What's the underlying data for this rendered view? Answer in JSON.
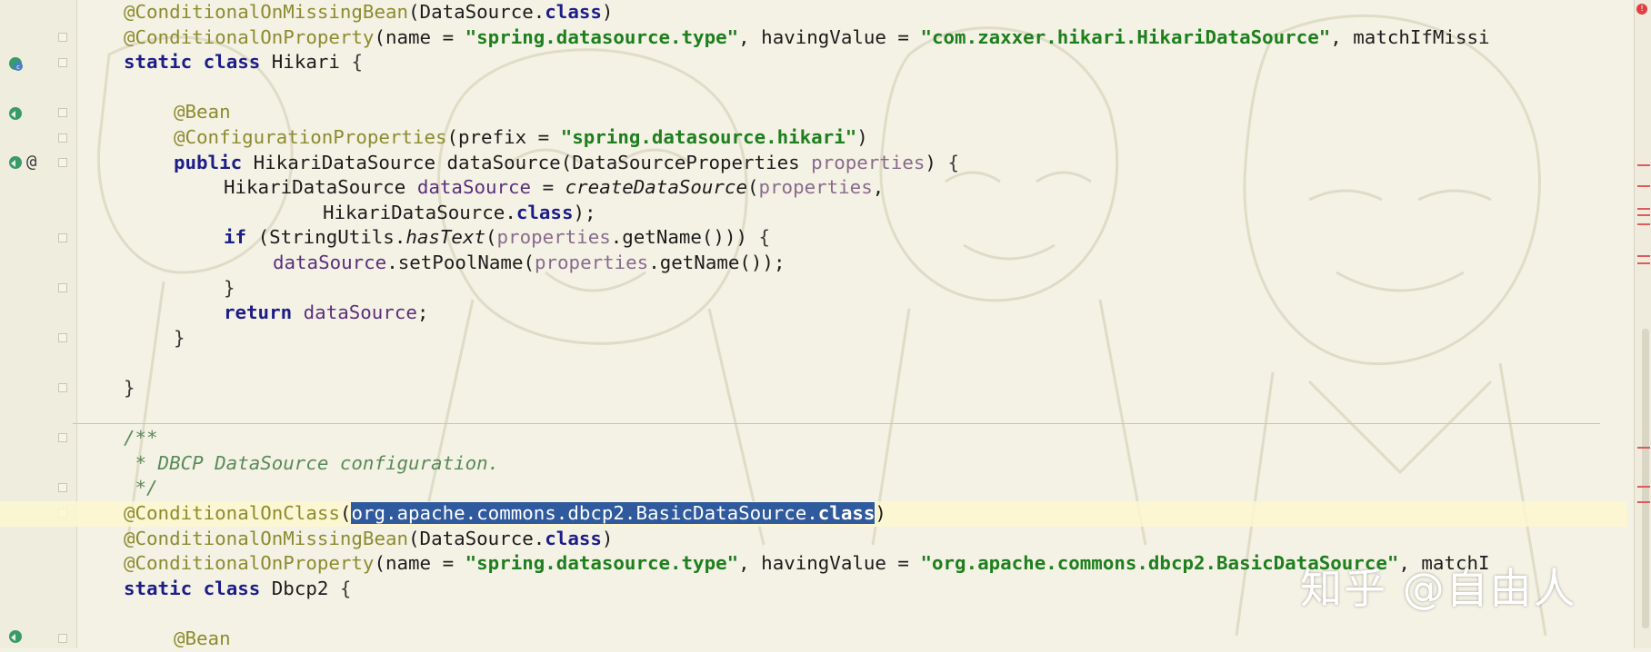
{
  "gutter": {
    "at_symbol": "@"
  },
  "lines": [
    [
      "@ConditionalOnMissingBean",
      "(DataSource.",
      "class",
      ")"
    ],
    [
      "@ConditionalOnProperty",
      "(name = ",
      "\"spring.datasource.type\"",
      ", havingValue = ",
      "\"com.zaxxer.hikari.HikariDataSource\"",
      ", matchIfMissi"
    ],
    [
      "static",
      " ",
      "class",
      " Hikari ",
      "{"
    ],
    [],
    [
      "@Bean"
    ],
    [
      "@ConfigurationProperties",
      "(prefix = ",
      "\"spring.datasource.hikari\"",
      ")"
    ],
    [
      "public",
      " HikariDataSource dataSource(DataSourceProperties ",
      "properties",
      ") ",
      "{"
    ],
    [
      "HikariDataSource ",
      "dataSource",
      " = ",
      "createDataSource",
      "(",
      "properties",
      ","
    ],
    [
      "HikariDataSource.",
      "class",
      ");"
    ],
    [
      "if",
      " (StringUtils.",
      "hasText",
      "(",
      "properties",
      ".getName())) ",
      "{"
    ],
    [
      "dataSource",
      ".setPoolName(",
      "properties",
      ".getName());"
    ],
    [
      "}"
    ],
    [
      "return",
      " ",
      "dataSource",
      ";"
    ],
    [
      "}"
    ],
    [],
    [
      "}"
    ],
    [],
    [
      "/**"
    ],
    [
      " * DBCP DataSource configuration."
    ],
    [
      " */"
    ],
    [
      "@ConditionalOnClass",
      "(",
      "org.apache.commons.dbcp2.BasicDataSource.",
      "class",
      ")"
    ],
    [
      "@ConditionalOnMissingBean",
      "(DataSource.",
      "class",
      ")"
    ],
    [
      "@ConditionalOnProperty",
      "(name = ",
      "\"spring.datasource.type\"",
      ", havingValue = ",
      "\"org.apache.commons.dbcp2.BasicDataSource\"",
      ", matchI"
    ],
    [
      "static",
      " ",
      "class",
      " Dbcp2 ",
      "{"
    ],
    [],
    [
      "@Bean"
    ]
  ],
  "watermark": "知乎 @自由人",
  "error_indicator": "!",
  "colors": {
    "background": "#f4f2e4",
    "annotation": "#8d8b2f",
    "keyword": "#1d1d8a",
    "string": "#1e7f1e",
    "selection": "#2f5a9d",
    "comment": "#5a8a5a"
  }
}
